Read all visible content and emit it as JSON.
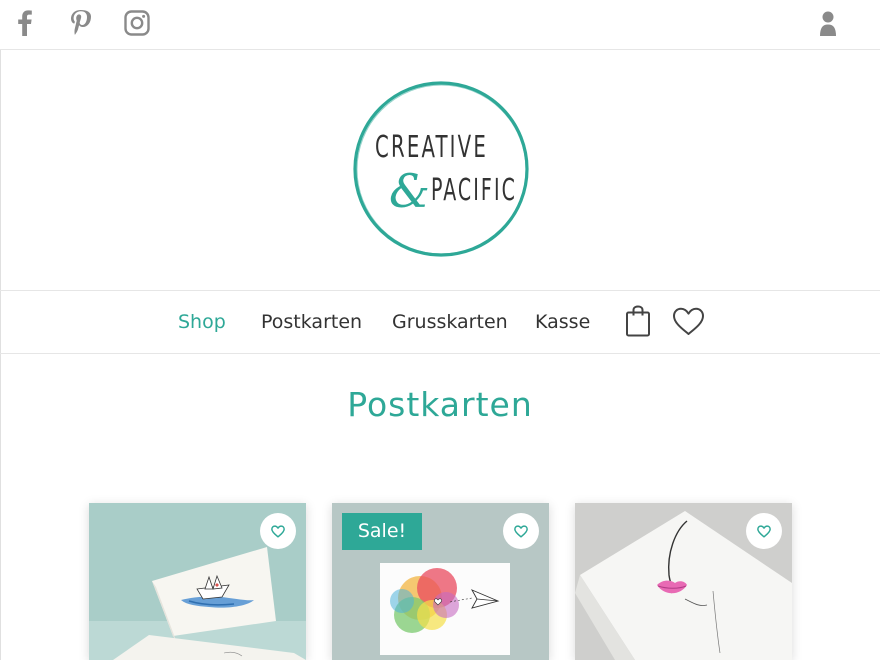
{
  "social": {
    "icons": [
      "facebook-icon",
      "pinterest-icon",
      "instagram-icon"
    ]
  },
  "account_icon": "user-icon",
  "logo": {
    "line1": "CREATIVE",
    "ampersand": "&",
    "line2": "PACIFIC"
  },
  "nav": {
    "items": [
      {
        "label": "Shop",
        "active": true
      },
      {
        "label": "Postkarten",
        "active": false
      },
      {
        "label": "Grusskarten",
        "active": false
      },
      {
        "label": "Kasse",
        "active": false
      }
    ],
    "cart_icon": "shopping-bag-icon",
    "wishlist_icon": "heart-icon"
  },
  "page": {
    "title": "Postkarten"
  },
  "products": [
    {
      "image": "paper-boat-watercolor-postcard",
      "sale": false
    },
    {
      "image": "rainbow-paper-plane-postcard",
      "sale": true,
      "badge": "Sale!"
    },
    {
      "image": "lips-line-art-postcard",
      "sale": false
    }
  ],
  "colors": {
    "accent": "#2ea897",
    "text": "#333333",
    "divider": "#e6e6e6",
    "icon_gray": "#8a8a8a"
  }
}
